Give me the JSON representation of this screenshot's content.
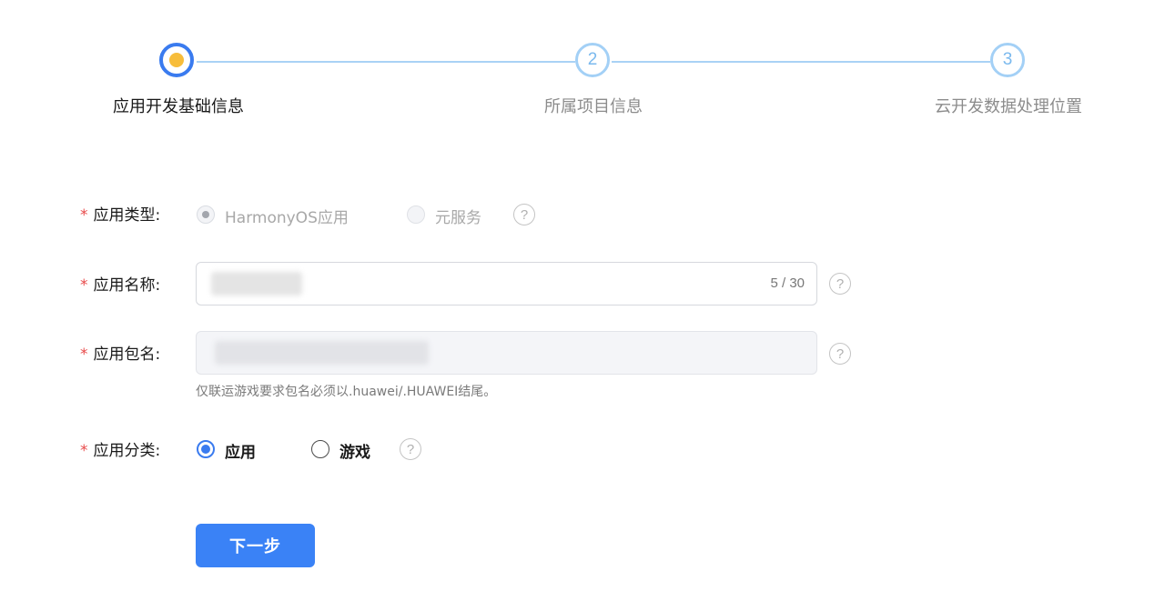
{
  "stepper": {
    "steps": [
      {
        "label": "应用开发基础信息",
        "number": "",
        "state": "active"
      },
      {
        "label": "所属项目信息",
        "number": "2",
        "state": "pending"
      },
      {
        "label": "云开发数据处理位置",
        "number": "3",
        "state": "pending"
      }
    ]
  },
  "form": {
    "required_mark": "*",
    "app_type": {
      "label": "应用类型:",
      "options": [
        "HarmonyOS应用",
        "元服务"
      ],
      "selected": "HarmonyOS应用"
    },
    "app_name": {
      "label": "应用名称:",
      "counter": "5 / 30"
    },
    "package_name": {
      "label": "应用包名:",
      "hint": "仅联运游戏要求包名必须以.huawei/.HUAWEI结尾。"
    },
    "app_category": {
      "label": "应用分类:",
      "options": [
        "应用",
        "游戏"
      ],
      "selected": "应用"
    },
    "help_glyph": "?"
  },
  "actions": {
    "next_label": "下一步"
  },
  "colors": {
    "primary": "#3a7bef",
    "step_dot": "#f7bd3b",
    "required": "#e84a4a",
    "connector": "#a9d2f5"
  }
}
